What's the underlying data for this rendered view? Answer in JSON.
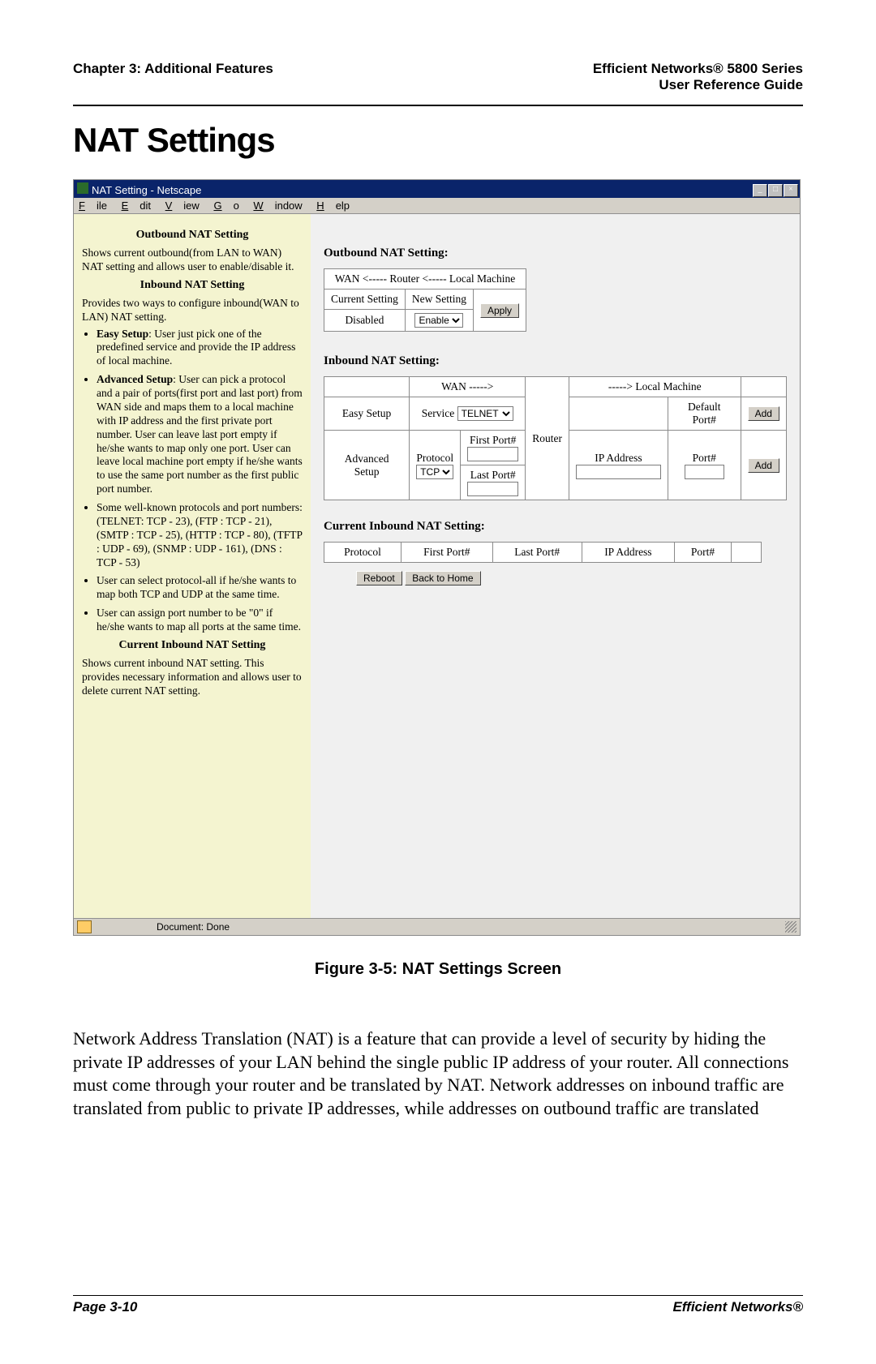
{
  "header": {
    "left": "Chapter 3: Additional Features",
    "right_line1": "Efficient Networks® 5800 Series",
    "right_line2": "User Reference Guide"
  },
  "title": "NAT Settings",
  "window": {
    "title": "NAT Setting - Netscape",
    "menus": [
      "File",
      "Edit",
      "View",
      "Go",
      "Window",
      "Help"
    ],
    "status": "Document: Done"
  },
  "sidebar": {
    "h_outbound": "Outbound NAT Setting",
    "p_outbound": "Shows current outbound(from LAN to WAN) NAT setting and allows user to enable/disable it.",
    "h_inbound": "Inbound NAT Setting",
    "p_inbound": "Provides two ways to configure inbound(WAN to LAN) NAT setting.",
    "bullets": [
      "Easy Setup: User just pick one of the predefined service and provide the IP address of local machine.",
      "Advanced Setup: User can pick a protocol and a pair of ports(first port and last port) from WAN side and maps them to a local machine with IP address and the first private port number. User can leave last port empty if he/she wants to map only one port. User can leave local machine port empty if he/she wants to use the same port number as the first public port number.",
      "Some well-known protocols and port numbers: (TELNET: TCP - 23), (FTP : TCP - 21), (SMTP : TCP - 25), (HTTP : TCP - 80), (TFTP : UDP - 69), (SNMP : UDP - 161), (DNS : TCP - 53)",
      "User can select protocol-all if he/she wants to map both TCP and UDP at the same time.",
      "User can assign port number to be \"0\" if he/she wants to map all ports at the same time."
    ],
    "h_current": "Current Inbound NAT Setting",
    "p_current": "Shows current inbound NAT setting. This provides necessary information and allows user to delete current NAT setting."
  },
  "outbound": {
    "heading": "Outbound NAT Setting:",
    "flow": "WAN <----- Router <----- Local Machine",
    "col_current": "Current Setting",
    "col_new": "New Setting",
    "value_current": "Disabled",
    "select_value": "Enable",
    "apply": "Apply"
  },
  "inbound": {
    "heading": "Inbound NAT Setting:",
    "wan": "WAN ----->",
    "local": "-----> Local Machine",
    "easy": "Easy Setup",
    "service": "Service",
    "service_val": "TELNET",
    "router": "Router",
    "default_port": "Default Port#",
    "add": "Add",
    "advanced": "Advanced Setup",
    "protocol": "Protocol",
    "protocol_val": "TCP",
    "first_port": "First Port#",
    "last_port": "Last Port#",
    "ip": "IP Address",
    "port": "Port#"
  },
  "current": {
    "heading": "Current Inbound NAT Setting:",
    "cols": [
      "Protocol",
      "First Port#",
      "Last Port#",
      "IP Address",
      "Port#"
    ],
    "reboot": "Reboot",
    "back": "Back to Home"
  },
  "figure_caption": "Figure 3-5:  NAT Settings Screen",
  "body": "Network Address Translation (NAT) is a feature that can provide a level of security by hiding the private IP addresses of your LAN behind the single public IP address of your router.  All connections must come through your router and be translated by NAT.  Network addresses on inbound traffic are translated from public to private IP addresses, while addresses on outbound traffic are translated",
  "footer": {
    "left": "Page 3-10",
    "right": "Efficient Networks®"
  }
}
